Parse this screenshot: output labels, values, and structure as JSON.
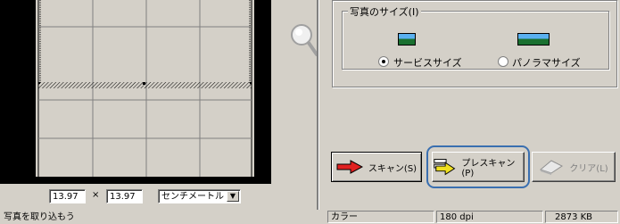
{
  "preview": {
    "width_value": "13.97",
    "times": "×",
    "height_value": "13.97",
    "unit_selected": "センチメートル"
  },
  "photo_size": {
    "legend": "写真のサイズ(I)",
    "options": [
      {
        "label": "サービスサイズ",
        "checked": true
      },
      {
        "label": "パノラマサイズ",
        "checked": false
      }
    ]
  },
  "buttons": {
    "scan": "スキャン(S)",
    "prescan": "プレスキャン(P)",
    "clear": "クリア(L)"
  },
  "status_bar": {
    "message": "写真を取り込もう",
    "color_mode": "カラー",
    "resolution": "180 dpi",
    "file_size": "2873 KB"
  },
  "colors": {
    "window_bg": "#d4d0c8",
    "highlight_ring": "#3a6fb0",
    "scan_arrow": "#e02020",
    "prescan_arrow": "#f0e020"
  },
  "icons": [
    "magnifier-icon",
    "service-size-thumb-icon",
    "panorama-size-thumb-icon",
    "red-arrow-icon",
    "yellow-arrow-icon",
    "eraser-icon"
  ]
}
